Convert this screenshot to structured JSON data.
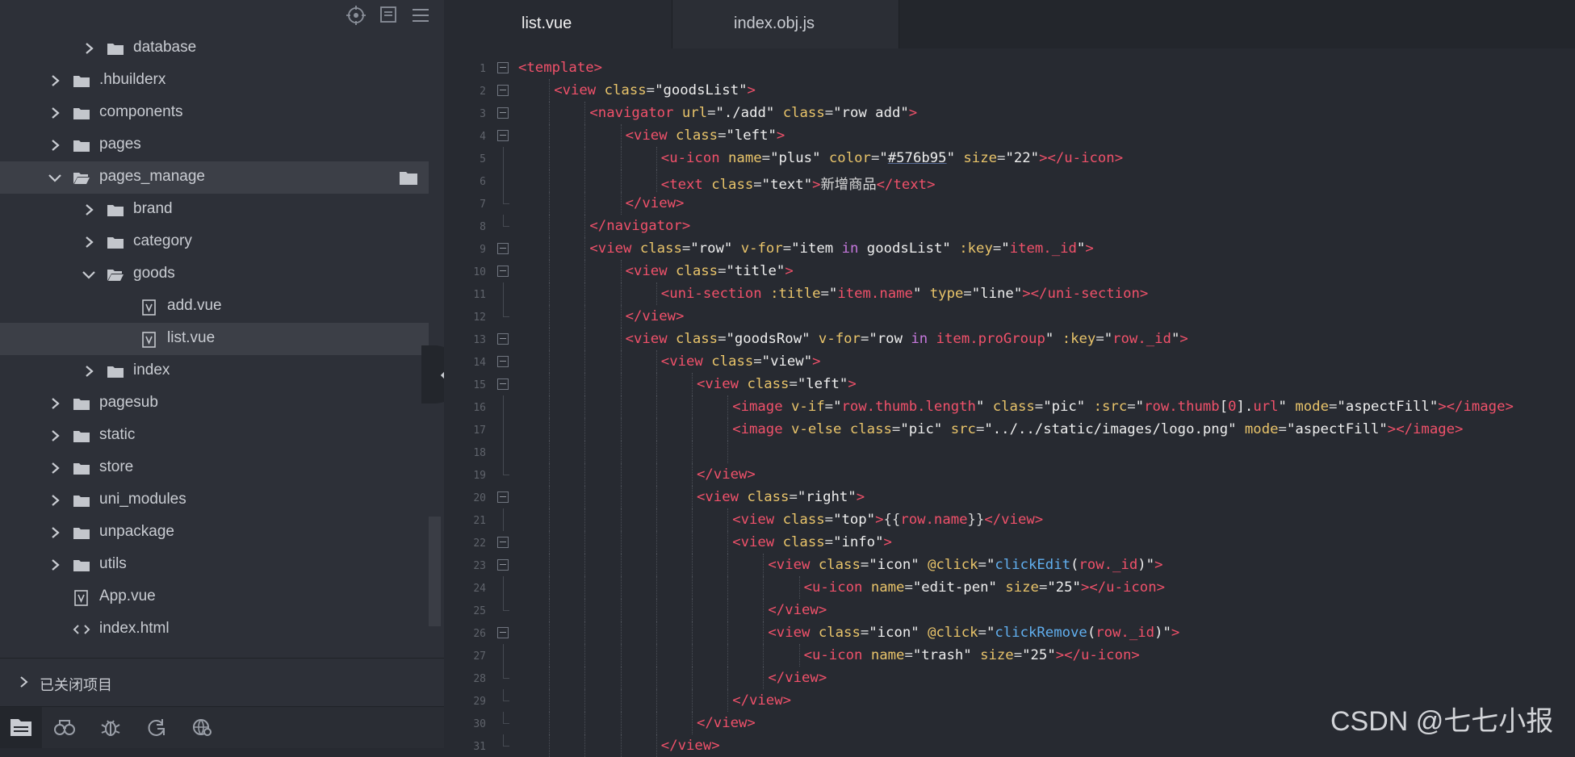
{
  "explorer": {
    "items": [
      {
        "label": "database",
        "type": "folder",
        "depth": 1,
        "expanded": false
      },
      {
        "label": ".hbuilderx",
        "type": "folder",
        "depth": 0,
        "expanded": false
      },
      {
        "label": "components",
        "type": "folder",
        "depth": 0,
        "expanded": false
      },
      {
        "label": "pages",
        "type": "folder",
        "depth": 0,
        "expanded": false
      },
      {
        "label": "pages_manage",
        "type": "folder",
        "depth": 0,
        "expanded": true
      },
      {
        "label": "brand",
        "type": "folder",
        "depth": 1,
        "expanded": false
      },
      {
        "label": "category",
        "type": "folder",
        "depth": 1,
        "expanded": false
      },
      {
        "label": "goods",
        "type": "folder",
        "depth": 1,
        "expanded": true
      },
      {
        "label": "add.vue",
        "type": "vue",
        "depth": 2
      },
      {
        "label": "list.vue",
        "type": "vue",
        "depth": 2,
        "selected": true
      },
      {
        "label": "index",
        "type": "folder",
        "depth": 1,
        "expanded": false
      },
      {
        "label": "pagesub",
        "type": "folder",
        "depth": 0,
        "expanded": false
      },
      {
        "label": "static",
        "type": "folder",
        "depth": 0,
        "expanded": false
      },
      {
        "label": "store",
        "type": "folder",
        "depth": 0,
        "expanded": false
      },
      {
        "label": "uni_modules",
        "type": "folder",
        "depth": 0,
        "expanded": false
      },
      {
        "label": "unpackage",
        "type": "folder",
        "depth": 0,
        "expanded": false
      },
      {
        "label": "utils",
        "type": "folder",
        "depth": 0,
        "expanded": false
      },
      {
        "label": "App.vue",
        "type": "vue",
        "depth": 0
      },
      {
        "label": "index.html",
        "type": "html",
        "depth": 0
      }
    ],
    "closed_projects_label": "已关闭项目",
    "toolbar_icons": [
      "locate-icon",
      "collapse-all-icon",
      "menu-icon"
    ],
    "bottom_icons": [
      "project-manager-icon",
      "search-icon",
      "debug-icon",
      "refresh-icon",
      "browser-icon"
    ]
  },
  "tabs": [
    {
      "label": "list.vue",
      "active": true
    },
    {
      "label": "index.obj.js",
      "active": false
    }
  ],
  "code_lines": [
    {
      "n": "1",
      "indent": 0,
      "fold": "start",
      "tokens": [
        [
          "tag",
          "<template>"
        ]
      ]
    },
    {
      "n": "2",
      "indent": 1,
      "fold": "start",
      "tokens": [
        [
          "tag",
          "<view "
        ],
        [
          "attr",
          "class"
        ],
        [
          "txt",
          "="
        ],
        [
          "str",
          "\"goodsList\""
        ],
        [
          "tag",
          ">"
        ]
      ]
    },
    {
      "n": "3",
      "indent": 2,
      "fold": "start",
      "tokens": [
        [
          "tag",
          "<navigator "
        ],
        [
          "attr",
          "url"
        ],
        [
          "txt",
          "="
        ],
        [
          "str",
          "\"./add\" "
        ],
        [
          "attr",
          "class"
        ],
        [
          "txt",
          "="
        ],
        [
          "str",
          "\"row add\""
        ],
        [
          "tag",
          ">"
        ]
      ]
    },
    {
      "n": "4",
      "indent": 3,
      "fold": "start",
      "tokens": [
        [
          "tag",
          "<view "
        ],
        [
          "attr",
          "class"
        ],
        [
          "txt",
          "="
        ],
        [
          "str",
          "\"left\""
        ],
        [
          "tag",
          ">"
        ]
      ]
    },
    {
      "n": "5",
      "indent": 4,
      "fold": "line",
      "tokens": [
        [
          "tag",
          "<u-icon "
        ],
        [
          "attr",
          "name"
        ],
        [
          "txt",
          "="
        ],
        [
          "str",
          "\"plus\" "
        ],
        [
          "attr",
          "color"
        ],
        [
          "txt",
          "="
        ],
        [
          "str",
          "\""
        ],
        [
          "color",
          "#576b95"
        ],
        [
          "str",
          "\" "
        ],
        [
          "attr",
          "size"
        ],
        [
          "txt",
          "="
        ],
        [
          "str",
          "\"22\""
        ],
        [
          "tag",
          "></u-icon>"
        ]
      ]
    },
    {
      "n": "6",
      "indent": 4,
      "fold": "line",
      "tokens": [
        [
          "tag",
          "<text "
        ],
        [
          "attr",
          "class"
        ],
        [
          "txt",
          "="
        ],
        [
          "str",
          "\"text\""
        ],
        [
          "tag",
          ">"
        ],
        [
          "txt",
          "新增商品"
        ],
        [
          "tag",
          "</text>"
        ]
      ]
    },
    {
      "n": "7",
      "indent": 3,
      "fold": "end",
      "tokens": [
        [
          "tag",
          "</view>"
        ]
      ]
    },
    {
      "n": "8",
      "indent": 2,
      "fold": "end",
      "tokens": [
        [
          "tag",
          "</navigator>"
        ]
      ]
    },
    {
      "n": "9",
      "indent": 2,
      "fold": "start",
      "tokens": [
        [
          "tag",
          "<view "
        ],
        [
          "attr",
          "class"
        ],
        [
          "txt",
          "="
        ],
        [
          "str",
          "\"row\" "
        ],
        [
          "attr",
          "v-for"
        ],
        [
          "txt",
          "="
        ],
        [
          "str",
          "\"item "
        ],
        [
          "kw",
          "in"
        ],
        [
          "str",
          " goodsList\" "
        ],
        [
          "attr",
          ":key"
        ],
        [
          "txt",
          "="
        ],
        [
          "str",
          "\""
        ],
        [
          "tag",
          "item._id"
        ],
        [
          "str",
          "\""
        ],
        [
          "tag",
          ">"
        ]
      ]
    },
    {
      "n": "10",
      "indent": 3,
      "fold": "start",
      "tokens": [
        [
          "tag",
          "<view "
        ],
        [
          "attr",
          "class"
        ],
        [
          "txt",
          "="
        ],
        [
          "str",
          "\"title\""
        ],
        [
          "tag",
          ">"
        ]
      ]
    },
    {
      "n": "11",
      "indent": 4,
      "fold": "line",
      "tokens": [
        [
          "tag",
          "<uni-section "
        ],
        [
          "attr",
          ":title"
        ],
        [
          "txt",
          "="
        ],
        [
          "str",
          "\""
        ],
        [
          "tag",
          "item.name"
        ],
        [
          "str",
          "\" "
        ],
        [
          "attr",
          "type"
        ],
        [
          "txt",
          "="
        ],
        [
          "str",
          "\"line\""
        ],
        [
          "tag",
          "></uni-section>"
        ]
      ]
    },
    {
      "n": "12",
      "indent": 3,
      "fold": "end",
      "tokens": [
        [
          "tag",
          "</view>"
        ]
      ]
    },
    {
      "n": "13",
      "indent": 3,
      "fold": "start",
      "tokens": [
        [
          "tag",
          "<view "
        ],
        [
          "attr",
          "class"
        ],
        [
          "txt",
          "="
        ],
        [
          "str",
          "\"goodsRow\" "
        ],
        [
          "attr",
          "v-for"
        ],
        [
          "txt",
          "="
        ],
        [
          "str",
          "\"row "
        ],
        [
          "kw",
          "in"
        ],
        [
          "str",
          " "
        ],
        [
          "tag",
          "item.proGroup"
        ],
        [
          "str",
          "\" "
        ],
        [
          "attr",
          ":key"
        ],
        [
          "txt",
          "="
        ],
        [
          "str",
          "\""
        ],
        [
          "tag",
          "row._id"
        ],
        [
          "str",
          "\""
        ],
        [
          "tag",
          ">"
        ]
      ]
    },
    {
      "n": "14",
      "indent": 4,
      "fold": "start",
      "tokens": [
        [
          "tag",
          "<view "
        ],
        [
          "attr",
          "class"
        ],
        [
          "txt",
          "="
        ],
        [
          "str",
          "\"view\""
        ],
        [
          "tag",
          ">"
        ]
      ]
    },
    {
      "n": "15",
      "indent": 5,
      "fold": "start",
      "tokens": [
        [
          "tag",
          "<view "
        ],
        [
          "attr",
          "class"
        ],
        [
          "txt",
          "="
        ],
        [
          "str",
          "\"left\""
        ],
        [
          "tag",
          ">"
        ]
      ]
    },
    {
      "n": "16",
      "indent": 6,
      "fold": "line",
      "tokens": [
        [
          "tag",
          "<image "
        ],
        [
          "attr",
          "v-if"
        ],
        [
          "txt",
          "="
        ],
        [
          "str",
          "\""
        ],
        [
          "tag",
          "row.thumb.length"
        ],
        [
          "str",
          "\" "
        ],
        [
          "attr",
          "class"
        ],
        [
          "txt",
          "="
        ],
        [
          "str",
          "\"pic\" "
        ],
        [
          "attr",
          ":src"
        ],
        [
          "txt",
          "="
        ],
        [
          "str",
          "\""
        ],
        [
          "tag",
          "row.thumb"
        ],
        [
          "str",
          "["
        ],
        [
          "tag",
          "0"
        ],
        [
          "str",
          "]."
        ],
        [
          "tag",
          "url"
        ],
        [
          "str",
          "\" "
        ],
        [
          "attr",
          "mode"
        ],
        [
          "txt",
          "="
        ],
        [
          "str",
          "\"aspectFill\""
        ],
        [
          "tag",
          "></image>"
        ]
      ]
    },
    {
      "n": "17",
      "indent": 6,
      "fold": "line",
      "tokens": [
        [
          "tag",
          "<image "
        ],
        [
          "attr",
          "v-else "
        ],
        [
          "attr",
          "class"
        ],
        [
          "txt",
          "="
        ],
        [
          "str",
          "\"pic\" "
        ],
        [
          "attr",
          "src"
        ],
        [
          "txt",
          "="
        ],
        [
          "str",
          "\"../../static/images/logo.png\" "
        ],
        [
          "attr",
          "mode"
        ],
        [
          "txt",
          "="
        ],
        [
          "str",
          "\"aspectFill\""
        ],
        [
          "tag",
          "></image>"
        ]
      ]
    },
    {
      "n": "18",
      "indent": 6,
      "fold": "line",
      "tokens": []
    },
    {
      "n": "19",
      "indent": 5,
      "fold": "end",
      "tokens": [
        [
          "tag",
          "</view>"
        ]
      ]
    },
    {
      "n": "20",
      "indent": 5,
      "fold": "start",
      "tokens": [
        [
          "tag",
          "<view "
        ],
        [
          "attr",
          "class"
        ],
        [
          "txt",
          "="
        ],
        [
          "str",
          "\"right\""
        ],
        [
          "tag",
          ">"
        ]
      ]
    },
    {
      "n": "21",
      "indent": 6,
      "fold": "line",
      "tokens": [
        [
          "tag",
          "<view "
        ],
        [
          "attr",
          "class"
        ],
        [
          "txt",
          "="
        ],
        [
          "str",
          "\"top\""
        ],
        [
          "tag",
          ">"
        ],
        [
          "txt",
          "{{"
        ],
        [
          "tag",
          "row.name"
        ],
        [
          "txt",
          "}}"
        ],
        [
          "tag",
          "</view>"
        ]
      ]
    },
    {
      "n": "22",
      "indent": 6,
      "fold": "start",
      "tokens": [
        [
          "tag",
          "<view "
        ],
        [
          "attr",
          "class"
        ],
        [
          "txt",
          "="
        ],
        [
          "str",
          "\"info\""
        ],
        [
          "tag",
          ">"
        ]
      ]
    },
    {
      "n": "23",
      "indent": 7,
      "fold": "start",
      "tokens": [
        [
          "tag",
          "<view "
        ],
        [
          "attr",
          "class"
        ],
        [
          "txt",
          "="
        ],
        [
          "str",
          "\"icon\" "
        ],
        [
          "attr",
          "@click"
        ],
        [
          "txt",
          "="
        ],
        [
          "str",
          "\""
        ],
        [
          "fn",
          "clickEdit"
        ],
        [
          "str",
          "("
        ],
        [
          "tag",
          "row._id"
        ],
        [
          "str",
          ")\""
        ],
        [
          "tag",
          ">"
        ]
      ]
    },
    {
      "n": "24",
      "indent": 8,
      "fold": "line",
      "tokens": [
        [
          "tag",
          "<u-icon "
        ],
        [
          "attr",
          "name"
        ],
        [
          "txt",
          "="
        ],
        [
          "str",
          "\"edit-pen\" "
        ],
        [
          "attr",
          "size"
        ],
        [
          "txt",
          "="
        ],
        [
          "str",
          "\"25\""
        ],
        [
          "tag",
          "></u-icon>"
        ]
      ]
    },
    {
      "n": "25",
      "indent": 7,
      "fold": "end",
      "tokens": [
        [
          "tag",
          "</view>"
        ]
      ]
    },
    {
      "n": "26",
      "indent": 7,
      "fold": "start",
      "tokens": [
        [
          "tag",
          "<view "
        ],
        [
          "attr",
          "class"
        ],
        [
          "txt",
          "="
        ],
        [
          "str",
          "\"icon\" "
        ],
        [
          "attr",
          "@click"
        ],
        [
          "txt",
          "="
        ],
        [
          "str",
          "\""
        ],
        [
          "fn",
          "clickRemove"
        ],
        [
          "str",
          "("
        ],
        [
          "tag",
          "row._id"
        ],
        [
          "str",
          ")\""
        ],
        [
          "tag",
          ">"
        ]
      ]
    },
    {
      "n": "27",
      "indent": 8,
      "fold": "line",
      "tokens": [
        [
          "tag",
          "<u-icon "
        ],
        [
          "attr",
          "name"
        ],
        [
          "txt",
          "="
        ],
        [
          "str",
          "\"trash\" "
        ],
        [
          "attr",
          "size"
        ],
        [
          "txt",
          "="
        ],
        [
          "str",
          "\"25\""
        ],
        [
          "tag",
          "></u-icon>"
        ]
      ]
    },
    {
      "n": "28",
      "indent": 7,
      "fold": "end",
      "tokens": [
        [
          "tag",
          "</view>"
        ]
      ]
    },
    {
      "n": "29",
      "indent": 6,
      "fold": "end",
      "tokens": [
        [
          "tag",
          "</view>"
        ]
      ]
    },
    {
      "n": "30",
      "indent": 5,
      "fold": "end",
      "tokens": [
        [
          "tag",
          "</view>"
        ]
      ]
    },
    {
      "n": "31",
      "indent": 4,
      "fold": "end",
      "tokens": [
        [
          "tag",
          "</view>"
        ]
      ]
    }
  ],
  "watermark": "CSDN @七七小报",
  "colors": {
    "sidebar_bg": "#2d3038",
    "editor_bg": "#272a31",
    "selected_row": "#3c3f47",
    "tag": "#f0516a",
    "attr": "#e9c46a",
    "keyword": "#c678dd",
    "function": "#61afef"
  }
}
